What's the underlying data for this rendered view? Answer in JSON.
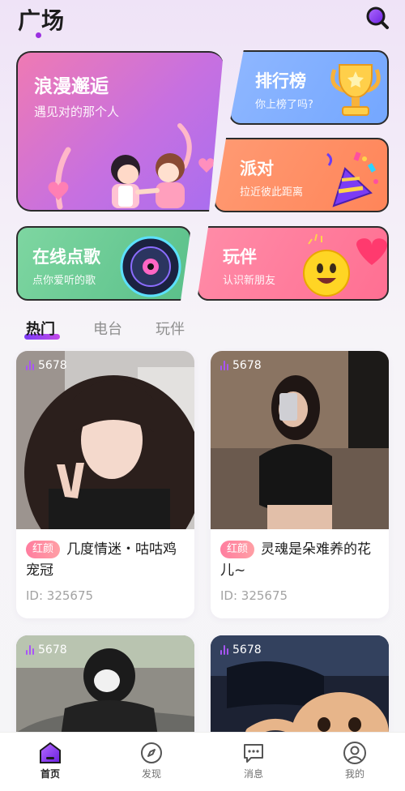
{
  "header": {
    "title": "广场"
  },
  "banners": {
    "romance": {
      "title": "浪漫邂逅",
      "subtitle": "遇见对的那个人"
    },
    "ranking": {
      "title": "排行榜",
      "subtitle": "你上榜了吗?"
    },
    "party": {
      "title": "派对",
      "subtitle": "拉近彼此距离"
    },
    "song": {
      "title": "在线点歌",
      "subtitle": "点你爱听的歌"
    },
    "companion": {
      "title": "玩伴",
      "subtitle": "认识新朋友"
    }
  },
  "tabs": [
    {
      "label": "热门",
      "active": true
    },
    {
      "label": "电台",
      "active": false
    },
    {
      "label": "玩伴",
      "active": false
    }
  ],
  "feed": [
    {
      "count": "5678",
      "badge": "红颜",
      "title": "几度情迷・咕咕鸡宠冠",
      "id": "ID: 325675"
    },
    {
      "count": "5678",
      "badge": "红颜",
      "title": "灵魂是朵难养的花儿~",
      "id": "ID: 325675"
    },
    {
      "count": "5678"
    },
    {
      "count": "5678"
    }
  ],
  "tabbar": [
    {
      "label": "首页",
      "icon": "home-icon",
      "active": true
    },
    {
      "label": "发现",
      "icon": "compass-icon",
      "active": false
    },
    {
      "label": "消息",
      "icon": "message-icon",
      "active": false
    },
    {
      "label": "我的",
      "icon": "profile-icon",
      "active": false
    }
  ],
  "colors": {
    "accent": "#9b2fe0",
    "badge": "#ff7d9f"
  }
}
